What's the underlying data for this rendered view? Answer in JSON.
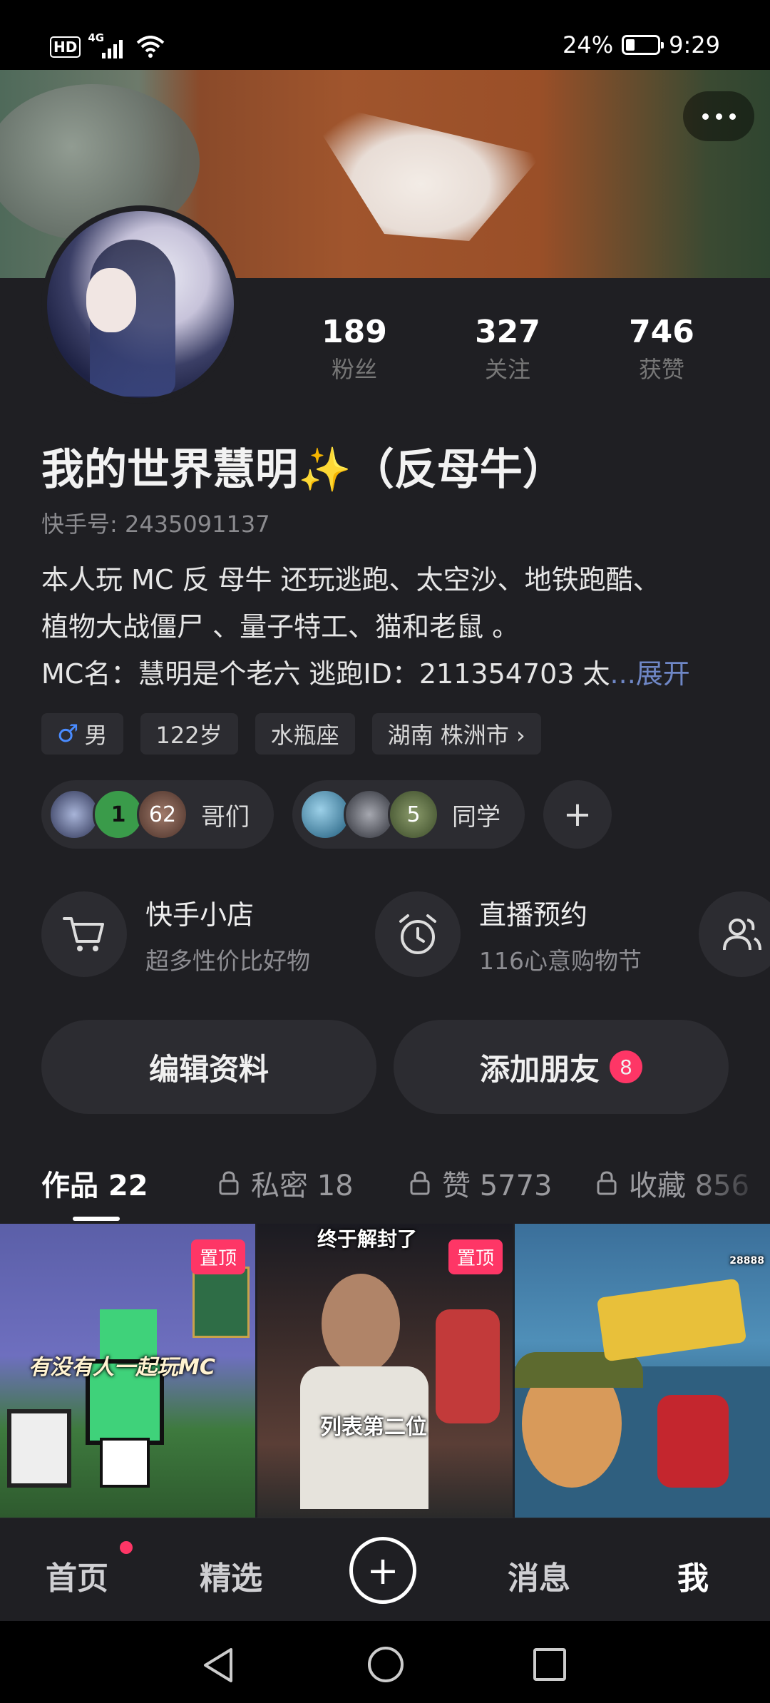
{
  "status_bar": {
    "hd": "HD",
    "network": "4G",
    "battery": "24%",
    "time": "9:29"
  },
  "profile": {
    "stats": [
      {
        "value": "189",
        "label": "粉丝"
      },
      {
        "value": "327",
        "label": "关注"
      },
      {
        "value": "746",
        "label": "获赞"
      }
    ],
    "name": "我的世界慧明✨（反母牛）",
    "kuaishou_id": "快手号: 2435091137",
    "bio_line1": "本人玩 MC 反 母牛 还玩逃跑、太空沙、地铁跑酷、",
    "bio_line2": "植物大战僵尸 、量子特工、猫和老鼠 。",
    "bio_line3": "MC名：慧明是个老六 逃跑ID：211354703 太",
    "bio_more": "...展开",
    "tags": {
      "gender_icon": "♂",
      "gender": "男",
      "age": "122岁",
      "zodiac": "水瓶座",
      "location": "湖南 株洲市 ›"
    }
  },
  "groups": [
    {
      "label": "哥们",
      "avatars": [
        "",
        "1",
        "62"
      ]
    },
    {
      "label": "同学",
      "avatars": [
        "",
        "",
        "5"
      ]
    }
  ],
  "group_add": "+",
  "features": [
    {
      "title": "快手小店",
      "subtitle": "超多性价比好物",
      "icon": "cart-icon"
    },
    {
      "title": "直播预约",
      "subtitle": "116心意购物节",
      "icon": "alarm-clock-icon"
    },
    {
      "icon": "people-icon"
    }
  ],
  "buttons": {
    "edit": "编辑资料",
    "add_friend": "添加朋友",
    "add_friend_badge": "8"
  },
  "tabs": [
    {
      "label": "作品 22"
    },
    {
      "label": "私密 18",
      "icon": "lock-icon"
    },
    {
      "label": "赞 5773",
      "icon": "lock-icon"
    },
    {
      "label": "收藏 856",
      "icon": "lock-icon"
    }
  ],
  "videos": [
    {
      "pinned": "置顶",
      "caption": "有没有人一起玩MC"
    },
    {
      "pinned": "置顶",
      "caption_top": "终于解封了",
      "caption": "列表第二位"
    },
    {
      "caption": "",
      "overlay": "28888"
    }
  ],
  "bottom_nav": {
    "home": "首页",
    "featured": "精选",
    "create": "+",
    "messages": "消息",
    "me": "我"
  }
}
